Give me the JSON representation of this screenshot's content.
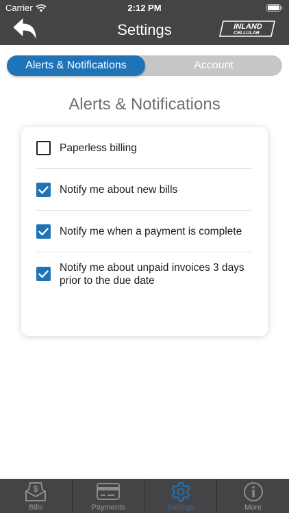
{
  "status_bar": {
    "carrier": "Carrier",
    "time": "2:12 PM",
    "icons": [
      "wifi-icon",
      "battery-icon"
    ]
  },
  "nav": {
    "title": "Settings",
    "back_icon": "back-arrow-icon",
    "logo": {
      "line1": "INLAND",
      "line2": "CELLULAR"
    }
  },
  "segments": {
    "active": "Alerts & Notifications",
    "inactive": "Account"
  },
  "section_title": "Alerts & Notifications",
  "options": [
    {
      "label": "Paperless billing",
      "checked": false
    },
    {
      "label": "Notify me about new bills",
      "checked": true
    },
    {
      "label": "Notify me when a payment is complete",
      "checked": true
    },
    {
      "label": "Notify me about unpaid invoices 3 days prior to the due date",
      "checked": true
    }
  ],
  "tabbar": {
    "items": [
      {
        "label": "Bills",
        "icon": "bill-dollar-icon",
        "selected": false
      },
      {
        "label": "Payments",
        "icon": "credit-card-icon",
        "selected": false
      },
      {
        "label": "Settings",
        "icon": "gear-icon",
        "selected": true
      },
      {
        "label": "More",
        "icon": "info-icon",
        "selected": false
      }
    ]
  },
  "colors": {
    "accent": "#1f73b7",
    "bar_background": "#444446",
    "segment_background": "#c6c6c6",
    "heading_gray": "#6e6e6e"
  }
}
